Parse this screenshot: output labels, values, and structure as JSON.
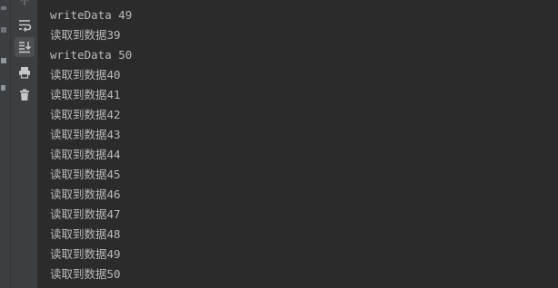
{
  "toolbar": {
    "buttons": [
      {
        "icon": "scroll-up-icon"
      },
      {
        "icon": "soft-wrap-icon"
      },
      {
        "icon": "scroll-to-end-icon"
      },
      {
        "icon": "print-icon"
      },
      {
        "icon": "trash-icon"
      }
    ]
  },
  "console": {
    "text_color": "#bbbbbb",
    "background": "#2b2b2b",
    "lines": [
      "writeData 49",
      "读取到数据39",
      "writeData 50",
      "读取到数据40",
      "读取到数据41",
      "读取到数据42",
      "读取到数据43",
      "读取到数据44",
      "读取到数据45",
      "读取到数据46",
      "读取到数据47",
      "读取到数据48",
      "读取到数据49",
      "读取到数据50"
    ]
  }
}
